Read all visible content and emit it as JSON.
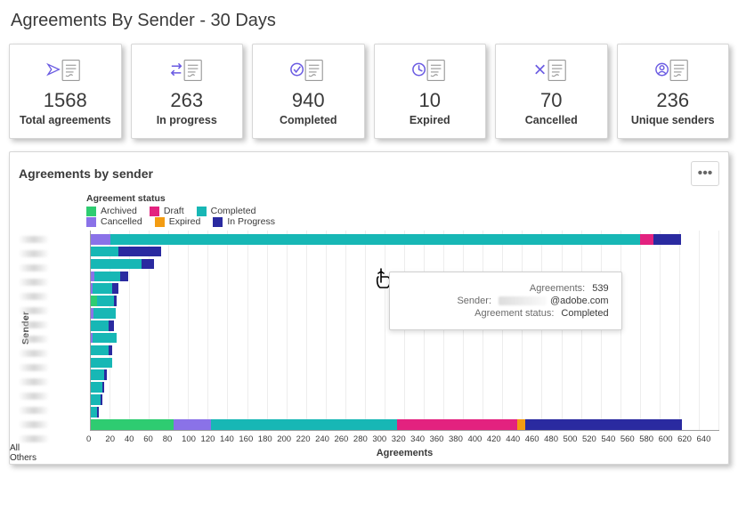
{
  "page": {
    "title": "Agreements By Sender - 30 Days"
  },
  "kpis": [
    {
      "value": "1568",
      "label": "Total agreements",
      "icon": "send-doc-icon"
    },
    {
      "value": "263",
      "label": "In progress",
      "icon": "progress-doc-icon"
    },
    {
      "value": "940",
      "label": "Completed",
      "icon": "check-doc-icon"
    },
    {
      "value": "10",
      "label": "Expired",
      "icon": "clock-doc-icon"
    },
    {
      "value": "70",
      "label": "Cancelled",
      "icon": "cancel-doc-icon"
    },
    {
      "value": "236",
      "label": "Unique senders",
      "icon": "user-doc-icon"
    }
  ],
  "chart": {
    "title": "Agreements by sender",
    "legend_title": "Agreement status",
    "legend": [
      {
        "name": "Archived",
        "color": "#2ecc71"
      },
      {
        "name": "Draft",
        "color": "#e3227f"
      },
      {
        "name": "Completed",
        "color": "#17b7b5"
      },
      {
        "name": "Cancelled",
        "color": "#8a72e8"
      },
      {
        "name": "Expired",
        "color": "#f39c12"
      },
      {
        "name": "In Progress",
        "color": "#2a2aa0"
      }
    ],
    "x_axis_label": "Agreements",
    "y_axis_label": "Sender",
    "x_ticks": [
      "0",
      "20",
      "40",
      "60",
      "80",
      "100",
      "120",
      "140",
      "160",
      "180",
      "200",
      "220",
      "240",
      "260",
      "280",
      "300",
      "320",
      "340",
      "360",
      "380",
      "400",
      "420",
      "440",
      "460",
      "480",
      "500",
      "520",
      "540",
      "560",
      "580",
      "600",
      "620",
      "640"
    ],
    "last_row_label": "All Others"
  },
  "tooltip": {
    "agreements_label": "Agreements:",
    "agreements_value": "539",
    "sender_label": "Sender:",
    "sender_suffix": "@adobe.com",
    "status_label": "Agreement status:",
    "status_value": "Completed"
  },
  "colors": {
    "Archived": "#2ecc71",
    "Draft": "#e3227f",
    "Completed": "#17b7b5",
    "Cancelled": "#8a72e8",
    "Expired": "#f39c12",
    "InProgress": "#2a2aa0"
  },
  "chart_data": {
    "type": "bar",
    "orientation": "horizontal",
    "stacked": true,
    "xlabel": "Agreements",
    "ylabel": "Sender",
    "xlim": [
      0,
      640
    ],
    "categories": [
      "Sender 1",
      "Sender 2",
      "Sender 3",
      "Sender 4",
      "Sender 5",
      "Sender 6",
      "Sender 7",
      "Sender 8",
      "Sender 9",
      "Sender 10",
      "Sender 11",
      "Sender 12",
      "Sender 13",
      "Sender 14",
      "Sender 15",
      "All Others"
    ],
    "series": [
      {
        "name": "Archived",
        "values": [
          0,
          0,
          0,
          0,
          0,
          6,
          0,
          0,
          0,
          0,
          0,
          0,
          0,
          0,
          0,
          84
        ]
      },
      {
        "name": "Cancelled",
        "values": [
          20,
          0,
          0,
          4,
          2,
          0,
          3,
          0,
          2,
          0,
          0,
          0,
          0,
          0,
          0,
          38
        ]
      },
      {
        "name": "Completed",
        "values": [
          539,
          28,
          52,
          26,
          20,
          18,
          22,
          18,
          24,
          18,
          22,
          14,
          12,
          10,
          6,
          190
        ]
      },
      {
        "name": "Draft",
        "values": [
          14,
          0,
          0,
          0,
          0,
          0,
          0,
          0,
          0,
          0,
          0,
          0,
          0,
          0,
          0,
          122
        ]
      },
      {
        "name": "Expired",
        "values": [
          0,
          0,
          0,
          0,
          0,
          0,
          0,
          0,
          0,
          0,
          0,
          0,
          0,
          0,
          0,
          8
        ]
      },
      {
        "name": "In Progress",
        "values": [
          28,
          44,
          12,
          8,
          6,
          2,
          0,
          6,
          0,
          4,
          0,
          2,
          2,
          2,
          2,
          160
        ]
      }
    ],
    "title": "Agreements by sender",
    "legend_title": "Agreement status"
  }
}
